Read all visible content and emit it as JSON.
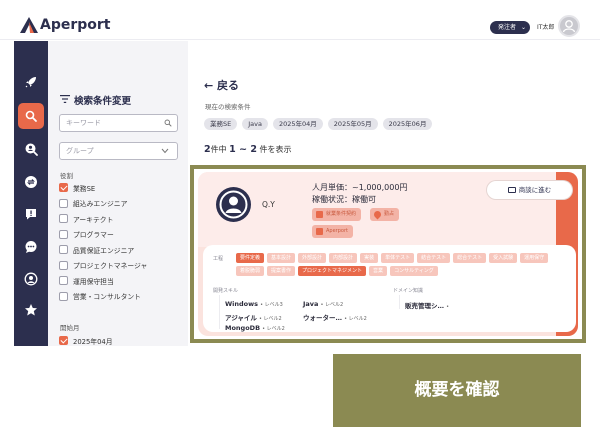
{
  "header": {
    "app_name": "Aperport",
    "role_label": "発注者",
    "user_name": "IT太郎"
  },
  "filters": {
    "title": "検索条件変更",
    "keyword_placeholder": "キーワード",
    "group_placeholder": "グループ",
    "role_section": "役割",
    "roles": [
      {
        "label": "業務SE",
        "checked": true
      },
      {
        "label": "組込みエンジニア",
        "checked": false
      },
      {
        "label": "アーキテクト",
        "checked": false
      },
      {
        "label": "プログラマー",
        "checked": false
      },
      {
        "label": "品質保証エンジニア",
        "checked": false
      },
      {
        "label": "プロジェクトマネージャ",
        "checked": false
      },
      {
        "label": "運用保守担当",
        "checked": false
      },
      {
        "label": "営業・コンサルタント",
        "checked": false
      }
    ],
    "start_section": "開始月",
    "start_months": [
      {
        "label": "2025年04月",
        "checked": true
      }
    ]
  },
  "main": {
    "back_label": "← 戻る",
    "current_conditions_label": "現在の検索条件",
    "condition_tags": [
      "業務SE",
      "Java",
      "2025年04月",
      "2025年05月",
      "2025年06月"
    ],
    "count": {
      "total": "2",
      "total_suffix": "件中",
      "range": "1 ~ 2",
      "range_suffix": "件を表示"
    }
  },
  "card": {
    "name": "Q.Y",
    "unit_price": "人月単価：~1,000,000円",
    "availability": "稼働状況：稼働可",
    "chip_contract": "就業条件契約",
    "chip_location": "勤占",
    "chip_company": "Aperport",
    "consult_button": "商談に進む",
    "process_label": "工程",
    "processes": [
      {
        "label": "要件定義",
        "on": true
      },
      {
        "label": "基本設計",
        "on": false
      },
      {
        "label": "外部設計",
        "on": false
      },
      {
        "label": "内部設計",
        "on": false
      },
      {
        "label": "実装",
        "on": false
      },
      {
        "label": "単体テスト",
        "on": false
      },
      {
        "label": "結合テスト",
        "on": false
      },
      {
        "label": "総合テスト",
        "on": false
      },
      {
        "label": "受入試験",
        "on": false
      },
      {
        "label": "運用保守",
        "on": false
      },
      {
        "label": "着脱脆弱",
        "on": false
      },
      {
        "label": "提案書作",
        "on": false
      },
      {
        "label": "プロジェクトマネジメント",
        "on": true
      },
      {
        "label": "営業",
        "on": false
      },
      {
        "label": "コンサルティング",
        "on": false
      }
    ],
    "dev_skill_label": "開発スキル",
    "domain_label": "ドメイン知識",
    "skills": [
      {
        "name": "Windows",
        "level": "• レベル3"
      },
      {
        "name": "Java",
        "level": "• レベル2"
      },
      {
        "name": "アジャイル",
        "level": "• レベル2"
      },
      {
        "name": "ウォーター…",
        "level": "• レベル2"
      },
      {
        "name": "MongoDB",
        "level": "• レベル2"
      }
    ],
    "domains": [
      {
        "name": "販売管理シ…",
        "level": "•"
      }
    ]
  },
  "overview_button": "概要を確認",
  "colors": {
    "navy": "#2c2f4e",
    "accent": "#e8694a",
    "olive": "#8b8a52"
  }
}
